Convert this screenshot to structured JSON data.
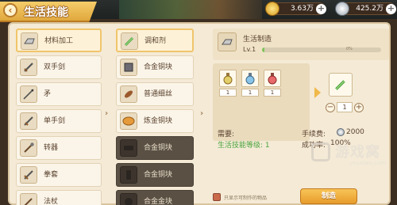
{
  "header": {
    "title": "生活技能",
    "back_icon": "back-arrow-icon",
    "gold": "3.63万",
    "silver": "425.2万"
  },
  "categories": [
    {
      "label": "材料加工",
      "icon": "ingot-icon",
      "selected": true
    },
    {
      "label": "双手剑",
      "icon": "sword-icon"
    },
    {
      "label": "矛",
      "icon": "spear-icon"
    },
    {
      "label": "单手剑",
      "icon": "sword-icon"
    },
    {
      "label": "转器",
      "icon": "staff-icon"
    },
    {
      "label": "拳套",
      "icon": "gauntlet-icon"
    },
    {
      "label": "法杖",
      "icon": "wand-icon"
    }
  ],
  "items": [
    {
      "label": "调和剂",
      "icon": "vial-icon",
      "selected": true
    },
    {
      "label": "合金铜块",
      "icon": "cube-icon"
    },
    {
      "label": "普通细丝",
      "icon": "thread-icon"
    },
    {
      "label": "炼金铜块",
      "icon": "ore-icon"
    },
    {
      "label": "合金铜块",
      "icon": "ingot-icon",
      "locked": true
    },
    {
      "label": "合金铜块",
      "icon": "ingot-icon",
      "locked": true
    },
    {
      "label": "合金金块",
      "icon": "ingot-icon",
      "locked": true
    }
  ],
  "detail": {
    "name": "生活制造",
    "level": "Lv.1",
    "xp_text": "0%",
    "xp_fraction": 0.02,
    "materials": [
      {
        "icon": "potion-yellow-icon",
        "count": "1"
      },
      {
        "icon": "potion-blue-icon",
        "count": "1"
      },
      {
        "icon": "potion-red-icon",
        "count": "1"
      }
    ],
    "output_icon": "vial-icon",
    "quantity": "1",
    "req_label": "需要:",
    "req_skill": "生活技能等级: 1",
    "fee_label": "手续费:",
    "fee_value": "2000",
    "rate_label": "成功率:",
    "rate_value": "100%",
    "checkbox_label": "只显示可制作的物品",
    "craft_button": "制造"
  },
  "watermark": {
    "text": "游戏窝",
    "url": "youxiwo.com"
  },
  "colors": {
    "accent": "#f0b94a",
    "green": "#4aa33c",
    "panel": "#f4ead6"
  }
}
